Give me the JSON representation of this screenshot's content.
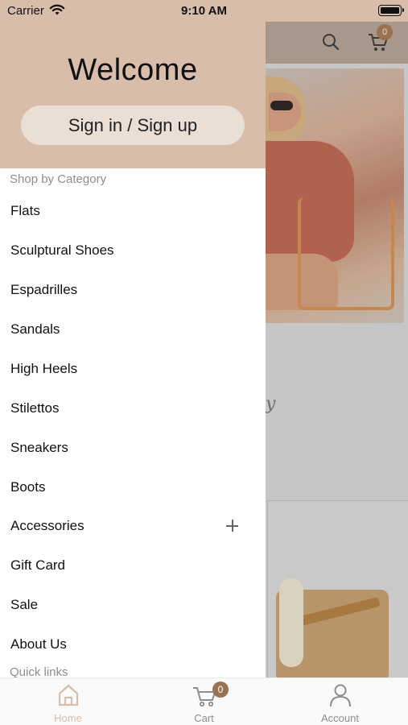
{
  "status_bar": {
    "carrier": "Carrier",
    "time": "9:10 AM"
  },
  "background": {
    "cart_count": "0",
    "script_text": "y"
  },
  "drawer": {
    "welcome": "Welcome",
    "signin_label": "Sign in / Sign up",
    "categories_heading": "Shop by Category",
    "categories": [
      {
        "label": "Flats"
      },
      {
        "label": "Sculptural Shoes"
      },
      {
        "label": "Espadrilles"
      },
      {
        "label": "Sandals"
      },
      {
        "label": "High Heels"
      },
      {
        "label": "Stilettos"
      },
      {
        "label": "Sneakers"
      },
      {
        "label": "Boots"
      },
      {
        "label": "Accessories",
        "expand_icon": "plus-icon"
      },
      {
        "label": "Gift Card"
      },
      {
        "label": "Sale"
      },
      {
        "label": "About Us"
      }
    ],
    "quick_links_heading": "Quick links"
  },
  "tab_bar": {
    "home": "Home",
    "cart": "Cart",
    "cart_count": "0",
    "account": "Account",
    "active": "home"
  },
  "colors": {
    "accent": "#d8bdab",
    "badge": "#9a7252"
  }
}
